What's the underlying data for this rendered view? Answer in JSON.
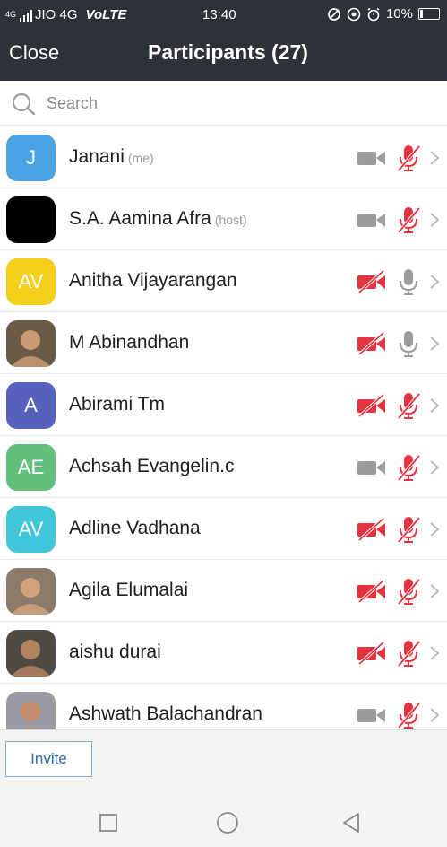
{
  "status_bar": {
    "network_type": "4G",
    "carrier": "JIO 4G",
    "volte": "VoLTE",
    "time": "13:40",
    "battery": "10%"
  },
  "header": {
    "close_label": "Close",
    "title": "Participants (27)"
  },
  "search": {
    "placeholder": "Search"
  },
  "colors": {
    "header_bg": "#2f3138",
    "muted_red": "#e4343f",
    "icon_gray": "#9c9c9c",
    "avatar_blue": "#4aa3e3",
    "avatar_yellow": "#f5cf1c",
    "avatar_indigo": "#5660bd",
    "avatar_green": "#63c07c",
    "avatar_teal": "#40c6d8"
  },
  "participants": [
    {
      "name": "Janani",
      "tag": "(me)",
      "avatar": {
        "type": "initials",
        "text": "J",
        "color": "#4aa3e3"
      },
      "video": "on",
      "audio": "muted"
    },
    {
      "name": "S.A. Aamina Afra",
      "tag": "(host)",
      "avatar": {
        "type": "image",
        "icon": "black-avatar"
      },
      "video": "on",
      "audio": "muted"
    },
    {
      "name": "Anitha Vijayarangan",
      "tag": "",
      "avatar": {
        "type": "initials",
        "text": "AV",
        "color": "#f5cf1c"
      },
      "video": "off",
      "audio": "unmuted"
    },
    {
      "name": "M Abinandhan",
      "tag": "",
      "avatar": {
        "type": "image",
        "icon": "photo-avatar"
      },
      "video": "off",
      "audio": "unmuted"
    },
    {
      "name": "Abirami Tm",
      "tag": "",
      "avatar": {
        "type": "initials",
        "text": "A",
        "color": "#5660bd"
      },
      "video": "off",
      "audio": "muted"
    },
    {
      "name": "Achsah Evangelin.c",
      "tag": "",
      "avatar": {
        "type": "initials",
        "text": "AE",
        "color": "#63c07c"
      },
      "video": "on",
      "audio": "muted"
    },
    {
      "name": "Adline Vadhana",
      "tag": "",
      "avatar": {
        "type": "initials",
        "text": "AV",
        "color": "#40c6d8"
      },
      "video": "off",
      "audio": "muted"
    },
    {
      "name": "Agila Elumalai",
      "tag": "",
      "avatar": {
        "type": "image",
        "icon": "photo-avatar"
      },
      "video": "off",
      "audio": "muted"
    },
    {
      "name": "aishu durai",
      "tag": "",
      "avatar": {
        "type": "image",
        "icon": "photo-avatar"
      },
      "video": "off",
      "audio": "muted"
    },
    {
      "name": "Ashwath Balachandran",
      "tag": "",
      "avatar": {
        "type": "image",
        "icon": "photo-avatar"
      },
      "video": "on",
      "audio": "muted"
    }
  ],
  "footer": {
    "invite_label": "Invite"
  }
}
